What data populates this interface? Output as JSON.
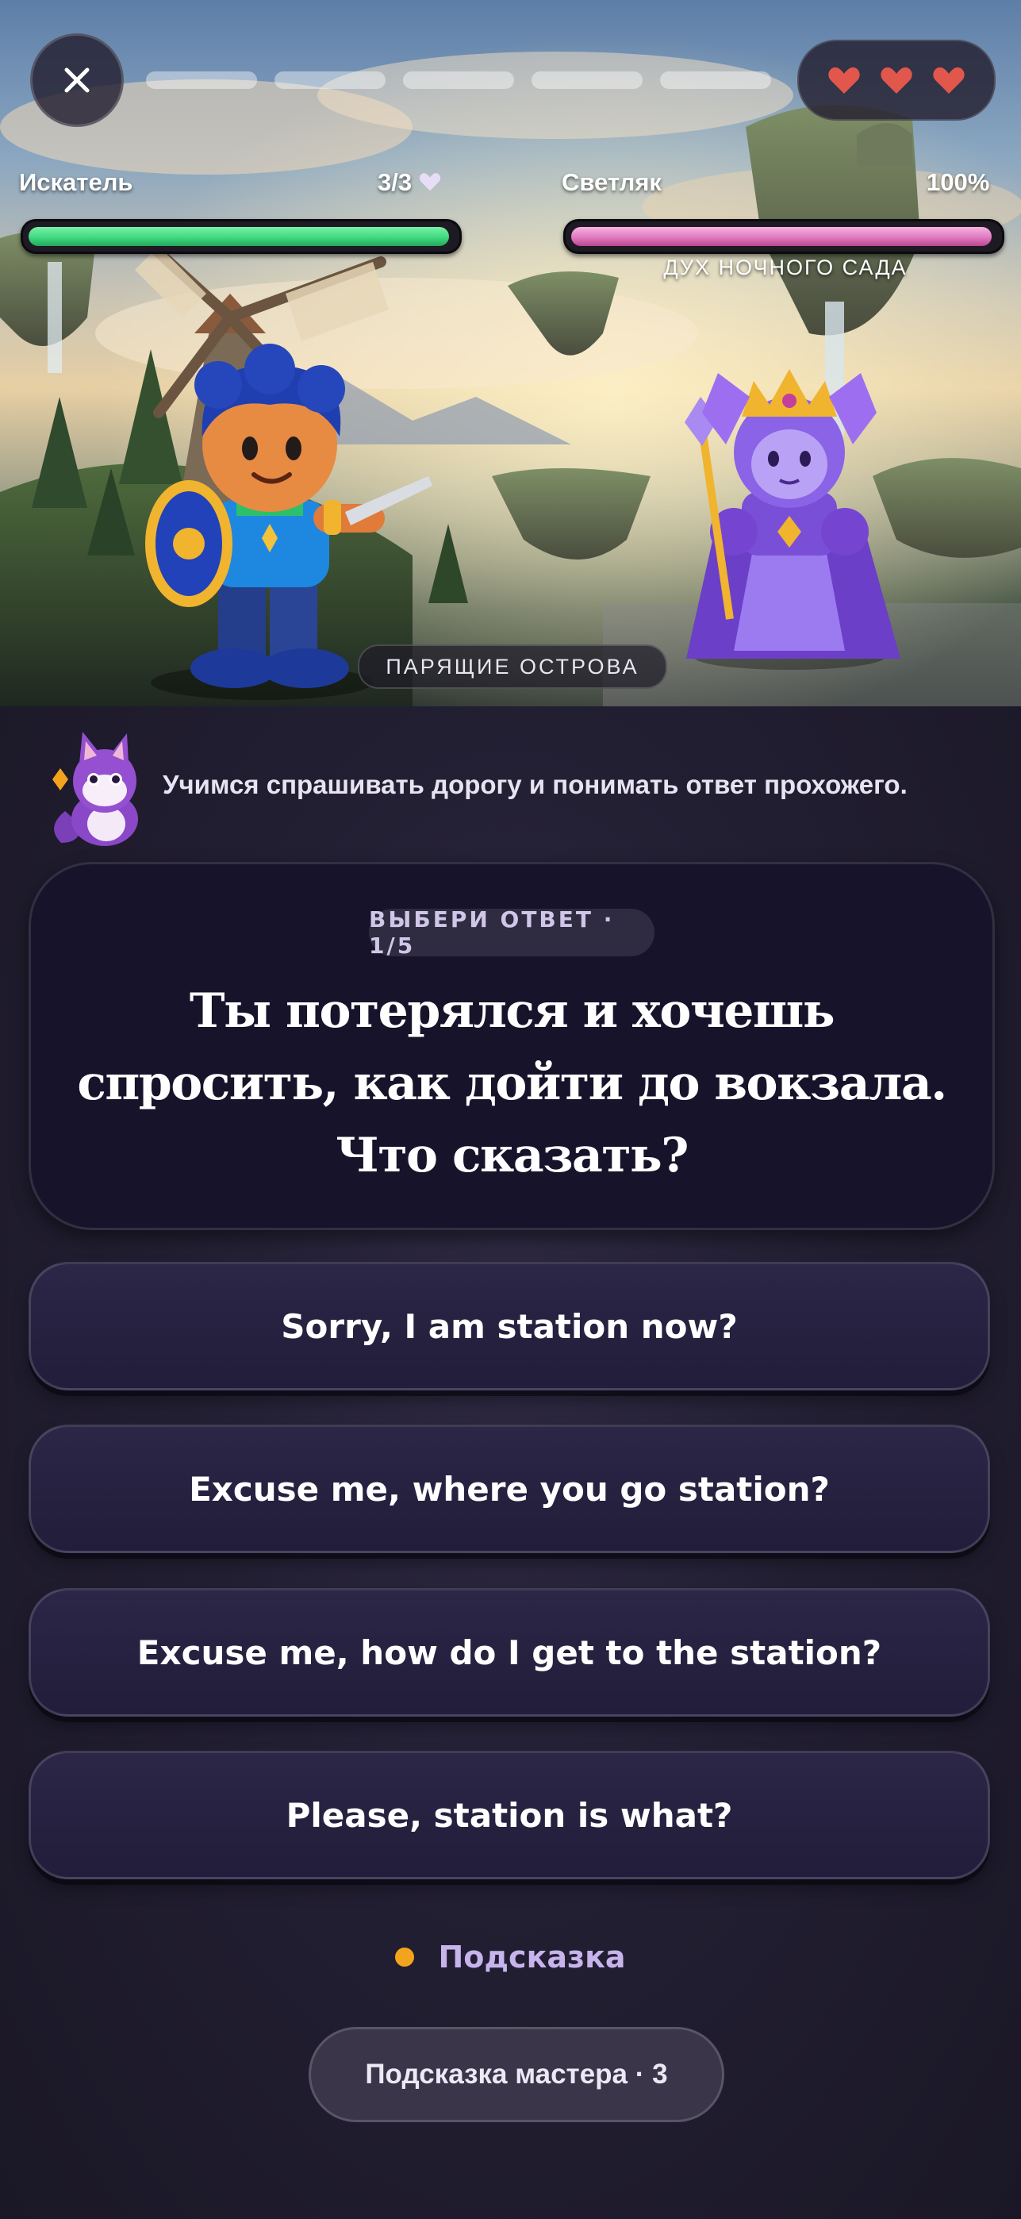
{
  "header": {
    "close_icon": "close-icon",
    "lesson_progress": {
      "total_segments": 5,
      "completed": 0
    },
    "lives": {
      "count": 3,
      "icon": "heart-icon",
      "color": "#e2574c"
    }
  },
  "battle": {
    "player": {
      "name": "Искатель",
      "hp_text": "3/3",
      "hp_icon": "heart-icon",
      "hp_fraction": 1.0,
      "bar_color": "#3fd97f"
    },
    "enemy": {
      "name": "Светляк",
      "hp_text": "100%",
      "hp_fraction": 1.0,
      "subtitle": "ДУХ НОЧНОГО САДА",
      "bar_color": "#e07ac0"
    },
    "location": "ПАРЯЩИЕ ОСТРОВА"
  },
  "tip": {
    "text": "Учимся спрашивать дорогу и понимать ответ прохожего.",
    "mascot_icon": "fox-mascot-icon"
  },
  "question": {
    "step_label": "ВЫБЕРИ ОТВЕТ · 1/5",
    "lines": [
      "Ты потерялся и хочешь",
      "спросить, как дойти до вокзала.",
      "Что сказать?"
    ]
  },
  "answers": [
    "Sorry, I am station now?",
    "Excuse me, where you go station?",
    "Excuse me, how do I get to the station?",
    "Please, station is what?"
  ],
  "hint": {
    "label": "Подсказка",
    "dot_color": "#f2a51c"
  },
  "master_hint": {
    "label": "Подсказка мастера · 3"
  }
}
